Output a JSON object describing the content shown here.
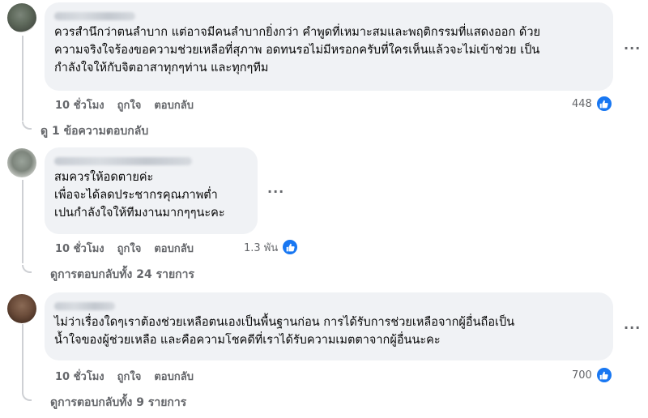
{
  "comments": [
    {
      "text": "ควรสำนึกว่าตนลำบาก แต่อาจมีคนลำบากยิ่งกว่า คำพูดที่เหมาะสมและพฤติกรรมที่แสดงออก ด้วย\nความจริงใจร้องขอความช่วยเหลือที่สุภาพ อดทนรอไม่มีหรอกครับที่ใครเห็นแล้วจะไม่เข้าช่วย เป็น\nกำลังใจให้กับจิตอาสาทุกๆท่าน และทุกๆทีม",
      "time": "10 ชั่วโมง",
      "like_label": "ถูกใจ",
      "reply_label": "ตอบกลับ",
      "reaction_count": "448",
      "replies_label": "ดู 1 ข้อความตอบกลับ"
    },
    {
      "text": "สมควรให้อดตายค่ะ\nเพื่อจะได้ลดประชากรคุณภาพต่ำ\nเปนกำลังใจให้ทีมงานมากๆๆนะคะ",
      "time": "10 ชั่วโมง",
      "like_label": "ถูกใจ",
      "reply_label": "ตอบกลับ",
      "reaction_count": "1.3 พัน",
      "replies_label": "ดูการตอบกลับทั้ง 24 รายการ"
    },
    {
      "text": "ไม่ว่าเรื่องใดๆเราต้องช่วยเหลือตนเองเป็นพื้นฐานก่อน การได้รับการช่วยเหลือจากผู้อื่นถือเป็น\nน้ำใจของผู้ช่วยเหลือ และคือความโชคดีที่เราได้รับความเมตตาจากผู้อื่นนะคะ",
      "time": "10 ชั่วโมง",
      "like_label": "ถูกใจ",
      "reply_label": "ตอบกลับ",
      "reaction_count": "700",
      "replies_label": "ดูการตอบกลับทั้ง 9 รายการ"
    }
  ],
  "more_glyph": "···",
  "colors": {
    "bubble": "#f0f2f5",
    "like_blue": "#1877f2",
    "muted": "#65676b"
  },
  "icons": {
    "reaction": "thumbs-up-icon",
    "more": "more-options-icon"
  }
}
